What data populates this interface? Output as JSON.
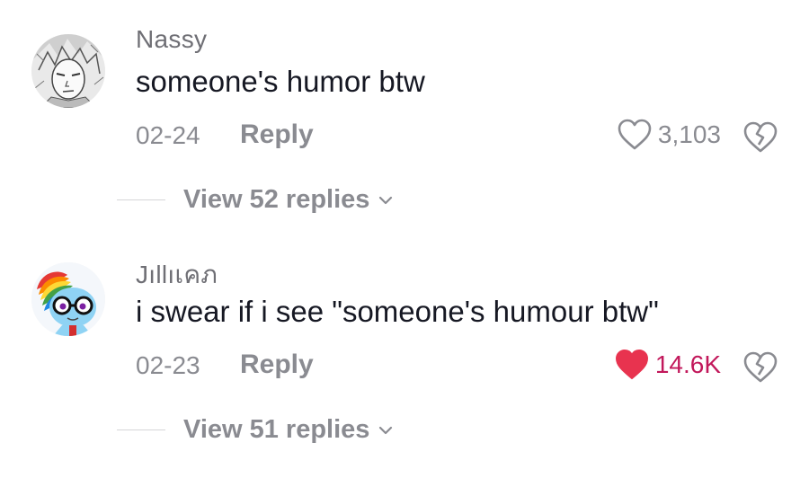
{
  "comments": [
    {
      "username": "Nassy",
      "text": "someone's humor btw",
      "date": "02-24",
      "reply_label": "Reply",
      "likes": "3,103",
      "liked": false,
      "replies_label": "View 52 replies"
    },
    {
      "username": "Jıllıเคภ",
      "text": "i swear if i see \"someone's humour btw\"",
      "date": "02-23",
      "reply_label": "Reply",
      "likes": "14.6K",
      "liked": true,
      "replies_label": "View 51 replies"
    }
  ],
  "colors": {
    "like_active": "#e8334f",
    "muted": "#8a8b91",
    "text": "#161823"
  }
}
